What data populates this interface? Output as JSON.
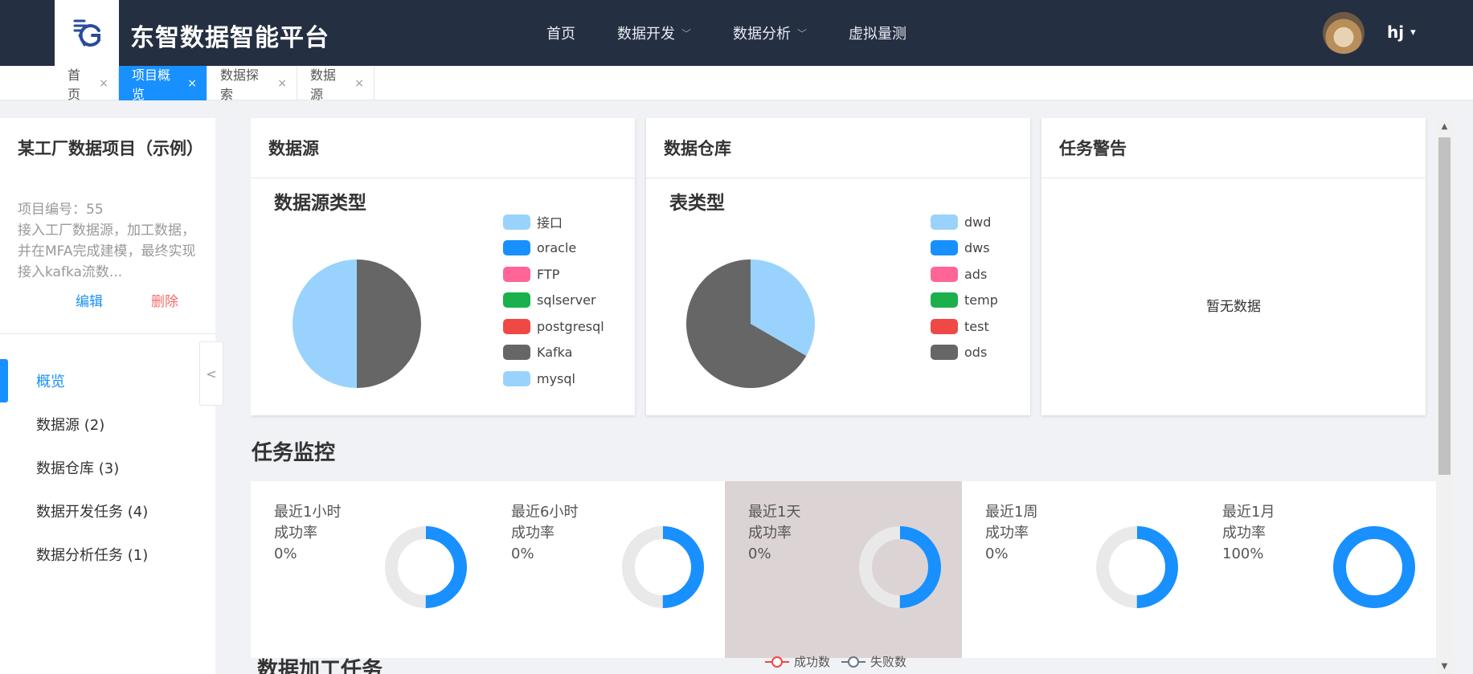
{
  "header": {
    "app_title": "东智数据智能平台",
    "nav": [
      {
        "label": "首页",
        "dropdown": false
      },
      {
        "label": "数据开发",
        "dropdown": true
      },
      {
        "label": "数据分析",
        "dropdown": true
      },
      {
        "label": "虚拟量测",
        "dropdown": false
      }
    ],
    "user": "hj",
    "caret": "▾",
    "chevron": "﹀"
  },
  "tabs": [
    {
      "label": "首页",
      "active": false
    },
    {
      "label": "项目概览",
      "active": true
    },
    {
      "label": "数据探索",
      "active": false
    },
    {
      "label": "数据源",
      "active": false
    }
  ],
  "tab_close": "×",
  "sidebar": {
    "project_title": "某工厂数据项目（示例）",
    "project_number": "项目编号：55",
    "description": "接入工厂数据源，加工数据，并在MFA完成建模，最终实现接入kafka流数...",
    "edit": "编辑",
    "delete": "删除",
    "items": [
      {
        "label": "概览",
        "active": true
      },
      {
        "label": "数据源 (2)",
        "active": false
      },
      {
        "label": "数据仓库 (3)",
        "active": false
      },
      {
        "label": "数据开发任务 (4)",
        "active": false
      },
      {
        "label": "数据分析任务 (1)",
        "active": false
      }
    ],
    "collapse_glyph": "<"
  },
  "cards": {
    "datasource": {
      "title": "数据源",
      "chart_title": "数据源类型",
      "legend": [
        {
          "label": "接口",
          "color": "#99d3fd"
        },
        {
          "label": "oracle",
          "color": "#1890ff"
        },
        {
          "label": "FTP",
          "color": "#ff6596"
        },
        {
          "label": "sqlserver",
          "color": "#1bb04b"
        },
        {
          "label": "postgresql",
          "color": "#f04844"
        },
        {
          "label": "Kafka",
          "color": "#666666"
        },
        {
          "label": "mysql",
          "color": "#99d3fd"
        }
      ]
    },
    "warehouse": {
      "title": "数据仓库",
      "chart_title": "表类型",
      "legend": [
        {
          "label": "dwd",
          "color": "#99d3fd"
        },
        {
          "label": "dws",
          "color": "#1890ff"
        },
        {
          "label": "ads",
          "color": "#ff6596"
        },
        {
          "label": "temp",
          "color": "#1bb04b"
        },
        {
          "label": "test",
          "color": "#f04844"
        },
        {
          "label": "ods",
          "color": "#666666"
        }
      ]
    },
    "alerts": {
      "title": "任务警告",
      "empty_text": "暂无数据"
    }
  },
  "chart_data": [
    {
      "type": "pie",
      "title": "数据源类型",
      "categories": [
        "Kafka",
        "mysql"
      ],
      "values": [
        1,
        1
      ],
      "colors": [
        "#666666",
        "#99d3fd"
      ]
    },
    {
      "type": "pie",
      "title": "表类型",
      "categories": [
        "dwd",
        "ods"
      ],
      "values": [
        1,
        2
      ],
      "colors": [
        "#99d3fd",
        "#666666"
      ]
    }
  ],
  "monitor": {
    "title": "任务监控",
    "items": [
      {
        "period": "最近1小时",
        "label": "成功率",
        "value": "0%",
        "fraction": 0.5,
        "highlight": false
      },
      {
        "period": "最近6小时",
        "label": "成功率",
        "value": "0%",
        "fraction": 0.5,
        "highlight": false
      },
      {
        "period": "最近1天",
        "label": "成功率",
        "value": "0%",
        "fraction": 0.5,
        "highlight": true
      },
      {
        "period": "最近1周",
        "label": "成功率",
        "value": "0%",
        "fraction": 0.5,
        "highlight": false
      },
      {
        "period": "最近1月",
        "label": "成功率",
        "value": "100%",
        "fraction": 1.0,
        "highlight": false
      }
    ],
    "donut_color": "#1890ff",
    "donut_track": "#e9e9e9"
  },
  "processing": {
    "title": "数据加工任务",
    "legend": [
      {
        "label": "成功数",
        "color": "#f04844"
      },
      {
        "label": "失败数",
        "color": "#6b7588"
      }
    ]
  },
  "scrollbar": {
    "up": "▲",
    "down": "▼"
  }
}
